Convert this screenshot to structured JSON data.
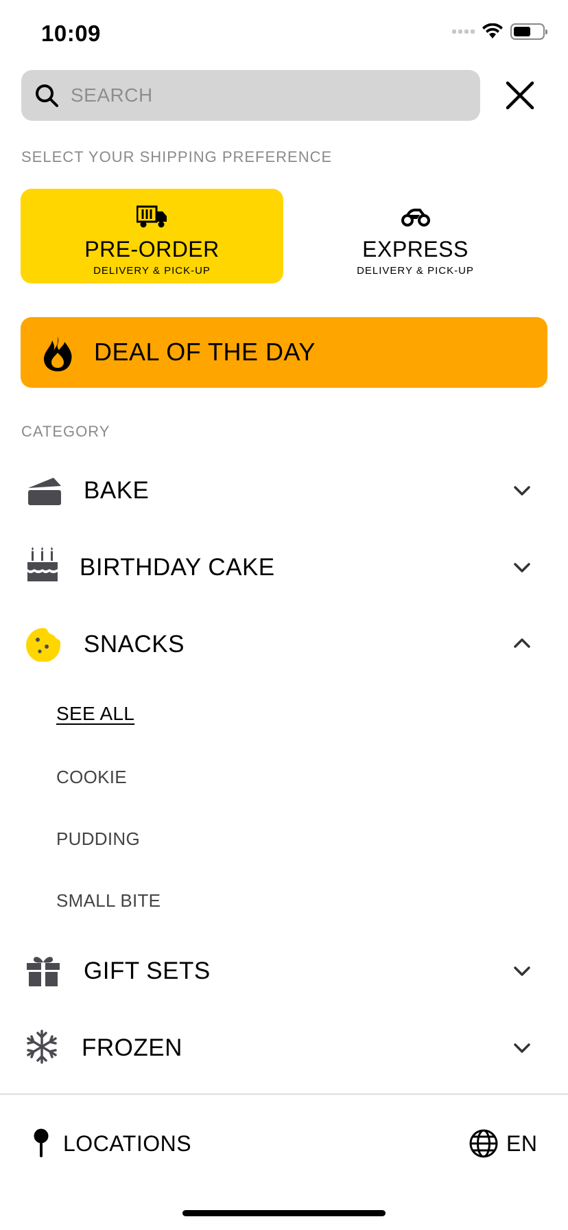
{
  "status_bar": {
    "time": "10:09"
  },
  "search": {
    "placeholder": "SEARCH",
    "value": ""
  },
  "shipping": {
    "heading": "SELECT YOUR SHIPPING PREFERENCE",
    "options": [
      {
        "title": "PRE-ORDER",
        "subtitle": "DELIVERY & PICK-UP",
        "icon": "truck-icon",
        "selected": true
      },
      {
        "title": "EXPRESS",
        "subtitle": "DELIVERY & PICK-UP",
        "icon": "scooter-icon",
        "selected": false
      }
    ],
    "active_color": "#FFD600"
  },
  "deal": {
    "label": "DEAL OF THE DAY",
    "icon": "flame-icon",
    "color": "#FFA500"
  },
  "category": {
    "heading": "CATEGORY",
    "items": [
      {
        "label": "BAKE",
        "icon": "cake-slice-icon",
        "expanded": false
      },
      {
        "label": "BIRTHDAY CAKE",
        "icon": "birthday-cake-icon",
        "expanded": false
      },
      {
        "label": "SNACKS",
        "icon": "cookie-icon",
        "expanded": true
      },
      {
        "label": "GIFT SETS",
        "icon": "gift-icon",
        "expanded": false
      },
      {
        "label": "FROZEN",
        "icon": "snowflake-icon",
        "expanded": false
      }
    ],
    "snacks_subitems": [
      "SEE ALL",
      "COOKIE",
      "PUDDING",
      "SMALL BITE"
    ]
  },
  "footer": {
    "locations_label": "LOCATIONS",
    "language_label": "EN"
  }
}
